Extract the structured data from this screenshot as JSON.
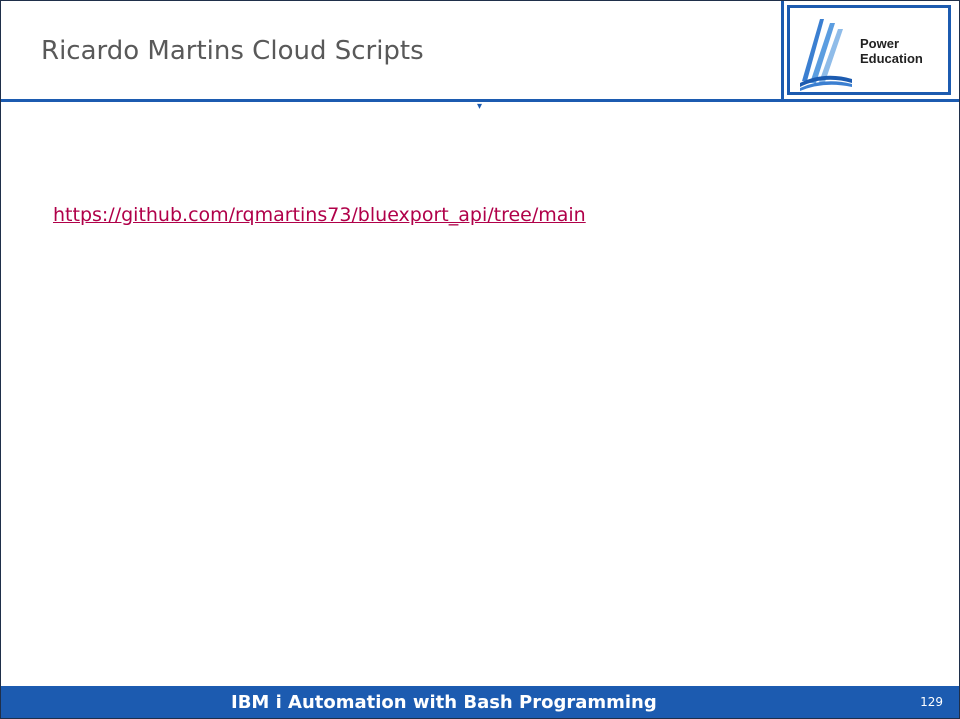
{
  "slide": {
    "title": "Ricardo Martins Cloud Scripts",
    "link_text": "https://github.com/rqmartins73/bluexport_api/tree/main"
  },
  "logo": {
    "line1": "Power",
    "line2": "Education"
  },
  "footer": {
    "title": "IBM i Automation with Bash Programming",
    "page_number": "129"
  },
  "colors": {
    "brand_blue": "#1c5bb0",
    "link_color": "#b00049",
    "title_gray": "#595959"
  }
}
